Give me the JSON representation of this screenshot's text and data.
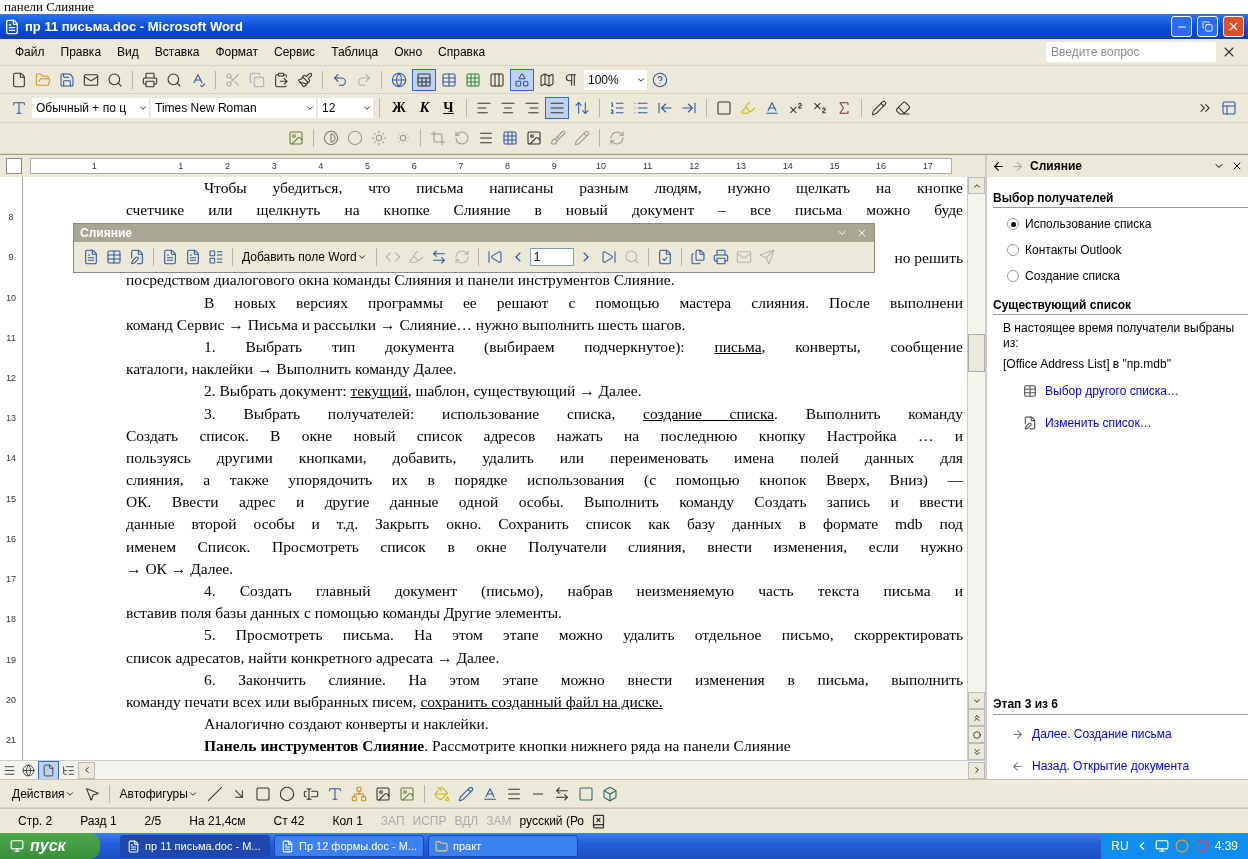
{
  "caption": "панели Слияние",
  "window": {
    "title": "пр 11 письма.doc - Microsoft Word"
  },
  "menu": [
    "Файл",
    "Правка",
    "Вид",
    "Вставка",
    "Формат",
    "Сервис",
    "Таблица",
    "Окно",
    "Справка"
  ],
  "help_field": {
    "placeholder": "Введите вопрос"
  },
  "standard_toolbar": {
    "tables_borders_on": true,
    "drawing_on": true,
    "zoom": "100%"
  },
  "formatting_toolbar": {
    "style": "Обычный + по ц",
    "font": "Times New Roman",
    "size": "12",
    "bold": "Ж",
    "italic": "К",
    "underline": "Ч",
    "justify_on": true
  },
  "horizontal_ruler": [
    "1",
    "1",
    "2",
    "3",
    "4",
    "5",
    "6",
    "7",
    "8",
    "9",
    "10",
    "11",
    "12",
    "13",
    "14",
    "15",
    "16",
    "17"
  ],
  "vertical_ruler": [
    "8",
    "9",
    "10",
    "11",
    "12",
    "13",
    "14",
    "15",
    "16",
    "17",
    "18",
    "19",
    "20",
    "21"
  ],
  "document": {
    "lines": [
      {
        "kind": "text",
        "text": "Чтобы убедиться, что письма написаны разным людям, нужно щелкать на кнопке",
        "indent": true,
        "justify": true
      },
      {
        "kind": "text",
        "text": "счетчике или щелкнуть на кнопке Слияние в новый документ – все письма можно буде",
        "indent": false,
        "justify": true
      },
      {
        "kind": "covered",
        "text": "но решить"
      },
      {
        "kind": "text",
        "text": "посредством диалогового окна команды Слияния и панели инструментов Слияние.",
        "indent": false,
        "justify": false
      },
      {
        "kind": "text",
        "text": "В новых версиях программы ее решают с помощью мастера слияния. После выполнени",
        "indent": true,
        "justify": true
      },
      {
        "kind": "text",
        "text": "команд Сервис → Письма и рассылки → Слияние… нужно выполнить шесть шагов.",
        "indent": false,
        "justify": false
      },
      {
        "kind": "parts",
        "parts": [
          {
            "text": "1. Выбрать тип документа (выбираем подчеркнутое): ",
            "underline": false
          },
          {
            "text": "письма",
            "underline": true
          },
          {
            "text": ", конверты, сообщение",
            "underline": false
          }
        ],
        "indent": true,
        "justify": true
      },
      {
        "kind": "text",
        "text": "каталоги, наклейки → Выполнить команду Далее.",
        "indent": false,
        "justify": false
      },
      {
        "kind": "parts",
        "parts": [
          {
            "text": "2. Выбрать документ: ",
            "underline": false
          },
          {
            "text": "текущий",
            "underline": true
          },
          {
            "text": ", шаблон, существующий  → Далее.",
            "underline": false
          }
        ],
        "indent": true,
        "justify": false
      },
      {
        "kind": "parts",
        "parts": [
          {
            "text": "3. Выбрать получателей: использование списка, ",
            "underline": false
          },
          {
            "text": "создание списка",
            "underline": true
          },
          {
            "text": ". Выполнить команду",
            "underline": false
          }
        ],
        "indent": true,
        "justify": true
      },
      {
        "kind": "text",
        "text": "Создать список. В окне новый список адресов нажать на последнюю кнопку Настройка … и",
        "indent": false,
        "justify": true
      },
      {
        "kind": "text",
        "text": "пользуясь другими кнопками, добавить, удалить или переименовать имена полей данных для",
        "indent": false,
        "justify": true
      },
      {
        "kind": "text",
        "text": "слияния, а также упорядочить их в порядке использования (с помощью кнопок Вверх, Вниз) —",
        "indent": false,
        "justify": true
      },
      {
        "kind": "text",
        "text": "ОК. Ввести адрес и другие данные одной особы. Выполнить команду Создать запись и ввести",
        "indent": false,
        "justify": true
      },
      {
        "kind": "text",
        "text": "данные второй особы и т.д. Закрыть окно. Сохранить список как базу данных в формате mdb под",
        "indent": false,
        "justify": true
      },
      {
        "kind": "text",
        "text": "именем Список. Просмотреть список в окне Получатели слияния, внести изменения, если нужно",
        "indent": false,
        "justify": true
      },
      {
        "kind": "text",
        "text": "→ ОК → Далее.",
        "indent": false,
        "justify": false
      },
      {
        "kind": "text",
        "text": "4. Создать главный документ (письмо), набрав неизменяемую часть текста письма и",
        "indent": true,
        "justify": true
      },
      {
        "kind": "text",
        "text": "вставив поля базы данных с помощью команды Другие элементы.",
        "indent": false,
        "justify": false
      },
      {
        "kind": "text",
        "text": "5. Просмотреть письма. На этом этапе можно удалить отдельное письмо, скорректировать",
        "indent": true,
        "justify": true
      },
      {
        "kind": "text",
        "text": "список адресатов, найти конкретного адресата → Далее.",
        "indent": false,
        "justify": false
      },
      {
        "kind": "text",
        "text": "6. Закончить слияние. На этом этапе можно внести изменения в письма, выполнить",
        "indent": true,
        "justify": true
      },
      {
        "kind": "parts",
        "parts": [
          {
            "text": "команду печати всех или выбранных писем, ",
            "underline": false
          },
          {
            "text": "сохранить созданный файл на диске.",
            "underline": true
          }
        ],
        "indent": false,
        "justify": false
      },
      {
        "kind": "text",
        "text": "Аналогично создают конверты и наклейки.",
        "indent": true,
        "justify": false
      },
      {
        "kind": "text",
        "text": "**Панель инструментов Слияние**. Рассмотрите кнопки нижнего ряда на панели Слияние",
        "indent": true,
        "justify": false
      }
    ]
  },
  "mail_merge_toolbar": {
    "title": "Слияние",
    "groups": [
      [
        {
          "kind": "letter",
          "disabled": false
        },
        {
          "kind": "source",
          "disabled": false
        },
        {
          "kind": "recipients",
          "disabled": false
        }
      ],
      [
        {
          "kind": "address",
          "disabled": false
        },
        {
          "kind": "greeting",
          "disabled": false
        },
        {
          "kind": "block",
          "disabled": false
        }
      ],
      [
        {
          "kind": "dropdown",
          "label": "Добавить поле Word",
          "disabled": false
        }
      ],
      [
        {
          "kind": "fields",
          "disabled": true
        },
        {
          "kind": "highlight",
          "disabled": true
        },
        {
          "kind": "match",
          "disabled": false
        },
        {
          "kind": "propagate",
          "disabled": true
        }
      ],
      [
        {
          "kind": "first",
          "disabled": false
        },
        {
          "kind": "previous",
          "disabled": false
        },
        {
          "kind": "record",
          "value": "1",
          "disabled": false
        },
        {
          "kind": "next",
          "disabled": false
        },
        {
          "kind": "last",
          "disabled": false
        },
        {
          "kind": "find",
          "disabled": true
        }
      ],
      [
        {
          "kind": "check",
          "disabled": false
        }
      ],
      [
        {
          "kind": "document",
          "disabled": false
        },
        {
          "kind": "printer",
          "disabled": false
        },
        {
          "kind": "email",
          "disabled": true
        },
        {
          "kind": "fax",
          "disabled": true
        }
      ]
    ]
  },
  "task_pane": {
    "title": "Слияние",
    "section_1": "Выбор получателей",
    "options": [
      {
        "label": "Использование списка",
        "selected": true
      },
      {
        "label": "Контакты Outlook",
        "selected": false
      },
      {
        "label": "Создание списка",
        "selected": false
      }
    ],
    "section_2": "Существующий список",
    "note": "В настоящее время получатели выбраны из:",
    "source": "[Office Address List] в \"пр.mdb\"",
    "links": [
      "Выбор другого списка…",
      "Изменить список…"
    ],
    "step": "Этап 3 из 6",
    "next": "Далее. Создание письма",
    "back": "Назад. Открытие документа"
  },
  "drawing_toolbar": {
    "actions": "Действия",
    "autoshapes": "Автофигуры"
  },
  "status_bar": {
    "items": [
      {
        "text": "Стр. 2",
        "disabled": false
      },
      {
        "text": "Разд 1",
        "disabled": false
      },
      {
        "text": "2/5",
        "disabled": false
      },
      {
        "text": "На 21,4см",
        "disabled": false
      },
      {
        "text": "Ст 42",
        "disabled": false
      },
      {
        "text": "Кол 1",
        "disabled": false
      },
      {
        "text": "ЗАП",
        "disabled": true
      },
      {
        "text": "ИСПР",
        "disabled": true
      },
      {
        "text": "ВДЛ",
        "disabled": true
      },
      {
        "text": "ЗАМ",
        "disabled": true
      },
      {
        "text": "русский (Ро",
        "disabled": false
      }
    ]
  },
  "taskbar": {
    "start": "пуск",
    "tasks": [
      {
        "label": "пр 11 письма.doc - M...",
        "selected": true
      },
      {
        "label": "Пр 12 формы.doc - M...",
        "selected": false
      },
      {
        "label": "практ",
        "selected": false
      }
    ],
    "language": "RU",
    "clock": "4:39"
  }
}
